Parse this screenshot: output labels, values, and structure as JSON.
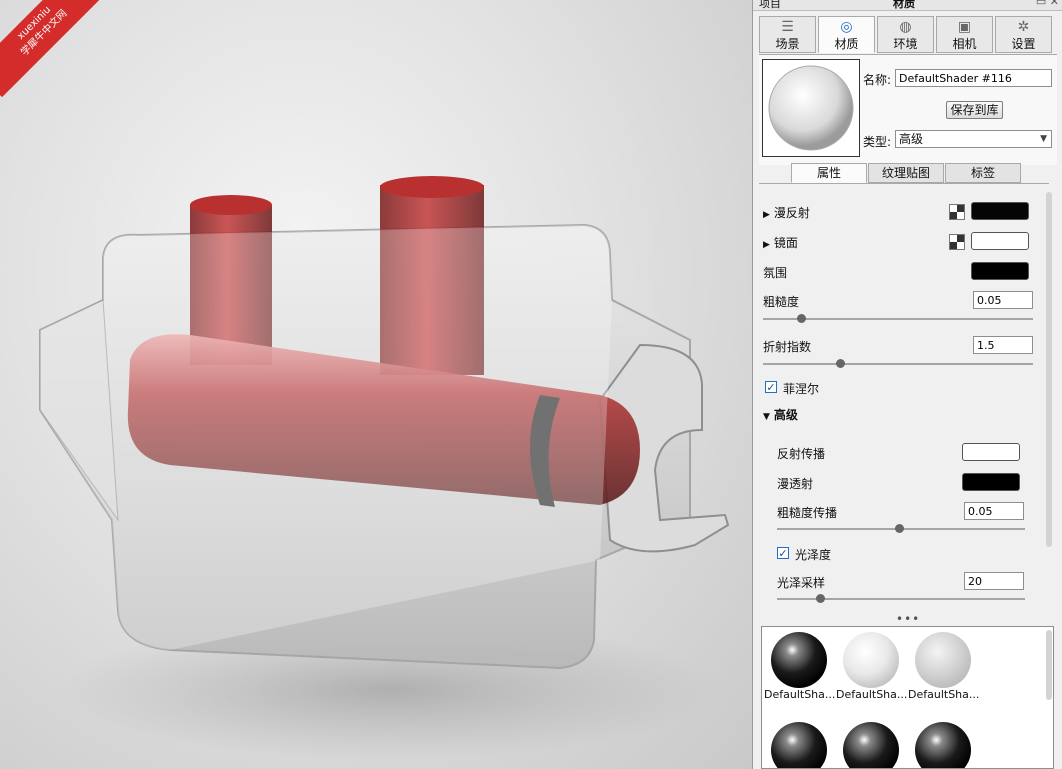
{
  "watermark": {
    "line1": "xuexiniu",
    "line2": "学犀牛中文网"
  },
  "topbar": {
    "project_label": "项目",
    "title": "材质",
    "buttons": "▭ ✕"
  },
  "tabs": [
    {
      "label": "场景",
      "icon": "list-icon"
    },
    {
      "label": "材质",
      "icon": "material-icon"
    },
    {
      "label": "环境",
      "icon": "globe-icon"
    },
    {
      "label": "相机",
      "icon": "camera-icon"
    },
    {
      "label": "设置",
      "icon": "gear-icon"
    }
  ],
  "material": {
    "name_label": "名称:",
    "name_value": "DefaultShader #116",
    "save_button": "保存到库",
    "type_label": "类型:",
    "type_value": "高级"
  },
  "subtabs": [
    "属性",
    "纹理贴图",
    "标签"
  ],
  "properties": {
    "diffuse": "漫反射",
    "specular": "镜面",
    "ambient": "氛围",
    "roughness_label": "粗糙度",
    "roughness_value": "0.05",
    "roughness_level": 0.05,
    "ior_label": "折射指数",
    "ior_value": "1.5",
    "fresnel_label": "菲涅尔",
    "fresnel_checked": true,
    "advanced_label": "高级",
    "reflection_spread": "反射传播",
    "transmission": "漫透射",
    "roughness_spread_label": "粗糙度传播",
    "roughness_spread_value": "0.05",
    "glossiness_label": "光泽度",
    "glossiness_checked": true,
    "gloss_samples_label": "光泽采样",
    "gloss_samples_value": "20"
  },
  "colors": {
    "diffuse": "#050505",
    "specular": "#ffffff",
    "ambient": "#000000",
    "reflection_spread": "#ffffff",
    "transmission": "#000000",
    "accent": "#1f6fc8"
  },
  "more_dots": "•••",
  "library": [
    {
      "name": "DefaultSha...",
      "style": "black"
    },
    {
      "name": "DefaultSha...",
      "style": "clear"
    },
    {
      "name": "DefaultSha...",
      "style": "grey"
    },
    {
      "name": "",
      "style": "black"
    },
    {
      "name": "",
      "style": "black"
    },
    {
      "name": "",
      "style": "black"
    }
  ]
}
